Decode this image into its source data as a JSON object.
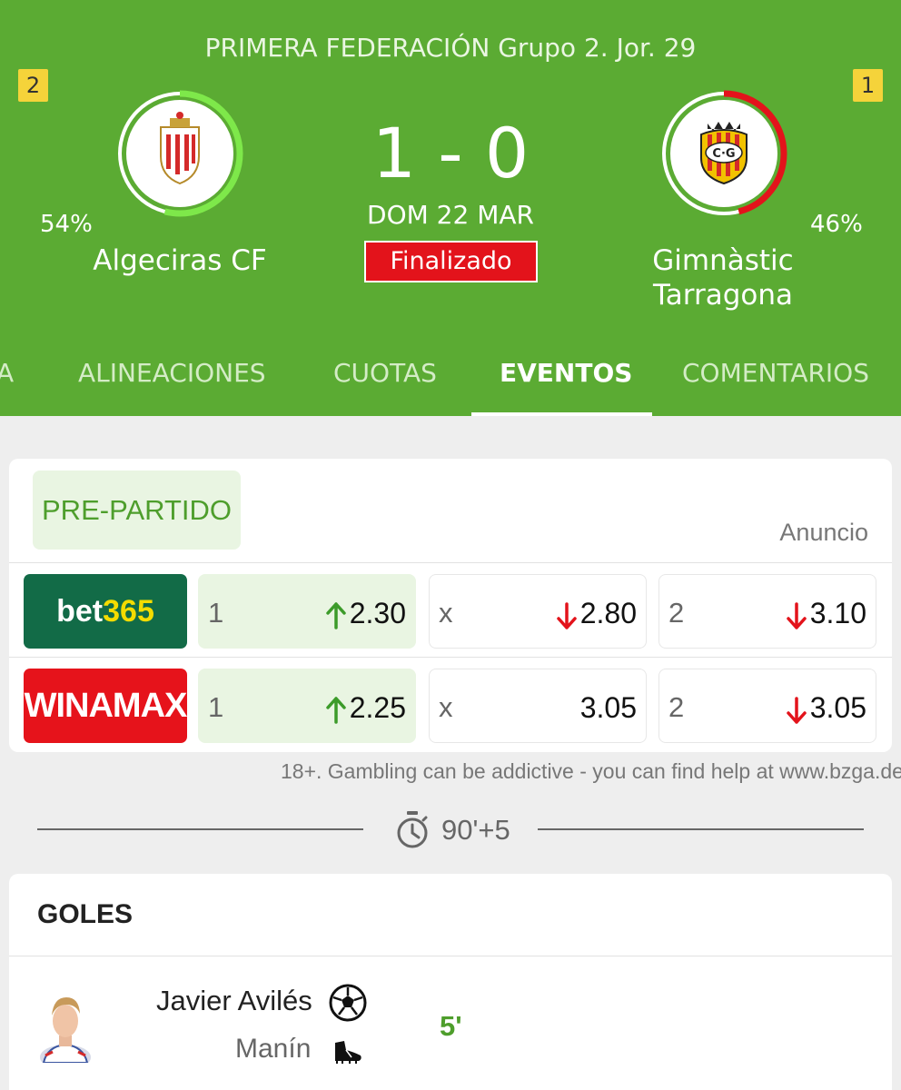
{
  "header": {
    "competition": "PRIMERA FEDERACIÓN Grupo 2.  Jor. 29",
    "home": {
      "name": "Algeciras CF",
      "rank_badge": "2",
      "percent": "54%",
      "ring_color": "#7ee84a"
    },
    "away": {
      "name_line1": "Gimnàstic",
      "name_line2": "Tarragona",
      "rank_badge": "1",
      "percent": "46%",
      "ring_color": "#e3131b"
    },
    "score": "1 - 0",
    "date": "DOM 22 MAR",
    "status": "Finalizado"
  },
  "tabs": [
    {
      "label": "A",
      "active": false
    },
    {
      "label": "ALINEACIONES",
      "active": false
    },
    {
      "label": "CUOTAS",
      "active": false
    },
    {
      "label": "EVENTOS",
      "active": true
    },
    {
      "label": "COMENTARIOS",
      "active": false
    }
  ],
  "odds": {
    "section_label": "PRE-PARTIDO",
    "ad_label": "Anuncio",
    "bookmakers": [
      {
        "name_part1": "bet",
        "name_part2": "365",
        "odds": [
          {
            "label": "1",
            "value": "2.30",
            "trend": "up"
          },
          {
            "label": "x",
            "value": "2.80",
            "trend": "down"
          },
          {
            "label": "2",
            "value": "3.10",
            "trend": "down"
          }
        ]
      },
      {
        "name": "WINAMAX",
        "odds": [
          {
            "label": "1",
            "value": "2.25",
            "trend": "up"
          },
          {
            "label": "x",
            "value": "3.05",
            "trend": "none"
          },
          {
            "label": "2",
            "value": "3.05",
            "trend": "down"
          }
        ]
      }
    ],
    "disclaimer": "18+. Gambling can be addictive - you can find help at www.bzga.de"
  },
  "timeline": {
    "time": "90'+5",
    "icon": "stopwatch-icon"
  },
  "goals": {
    "title": "GOLES",
    "items": [
      {
        "scorer": "Javier Avilés",
        "assist": "Manín",
        "minute": "5'",
        "scorer_icon": "soccer-ball-icon",
        "assist_icon": "boot-icon"
      }
    ]
  },
  "colors": {
    "green": "#5bab33",
    "red": "#e3131b",
    "up_arrow": "#3c9b2a",
    "down_arrow": "#e3131b"
  }
}
